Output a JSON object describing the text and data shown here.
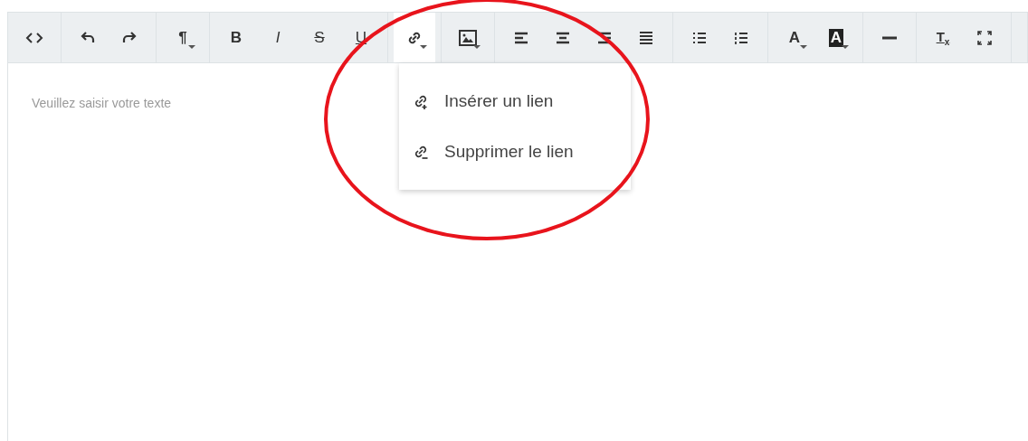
{
  "toolbar": {
    "groups": [
      {
        "items": [
          {
            "kind": "code"
          }
        ]
      },
      {
        "items": [
          {
            "kind": "undo"
          },
          {
            "kind": "redo"
          }
        ]
      },
      {
        "items": [
          {
            "kind": "paragraph",
            "label": "¶",
            "expanded": false
          }
        ]
      },
      {
        "items": [
          {
            "kind": "bold",
            "label": "B"
          },
          {
            "kind": "italic",
            "label": "I"
          },
          {
            "kind": "strike",
            "label": "S"
          },
          {
            "kind": "underline",
            "label": "U"
          }
        ]
      },
      {
        "items": [
          {
            "kind": "link",
            "expanded": true
          }
        ]
      },
      {
        "items": [
          {
            "kind": "image",
            "expanded": false
          }
        ]
      },
      {
        "items": [
          {
            "kind": "align-left"
          },
          {
            "kind": "align-center"
          },
          {
            "kind": "align-right"
          },
          {
            "kind": "justify"
          }
        ]
      },
      {
        "items": [
          {
            "kind": "bullet-list"
          },
          {
            "kind": "numbered-list"
          }
        ]
      },
      {
        "items": [
          {
            "kind": "color",
            "label": "A",
            "expanded": false
          },
          {
            "kind": "highlight",
            "label": "A",
            "expanded": false
          }
        ]
      },
      {
        "items": [
          {
            "kind": "rule"
          }
        ]
      },
      {
        "items": [
          {
            "kind": "clear",
            "label": "T$_{x}$"
          },
          {
            "kind": "fullscreen"
          }
        ]
      }
    ]
  },
  "link_menu": {
    "items": [
      {
        "kind": "insert",
        "label": "Insérer un lien"
      },
      {
        "kind": "remove",
        "label": "Supprimer le lien"
      }
    ]
  },
  "editor": {
    "placeholder": "Veuillez saisir votre texte"
  }
}
